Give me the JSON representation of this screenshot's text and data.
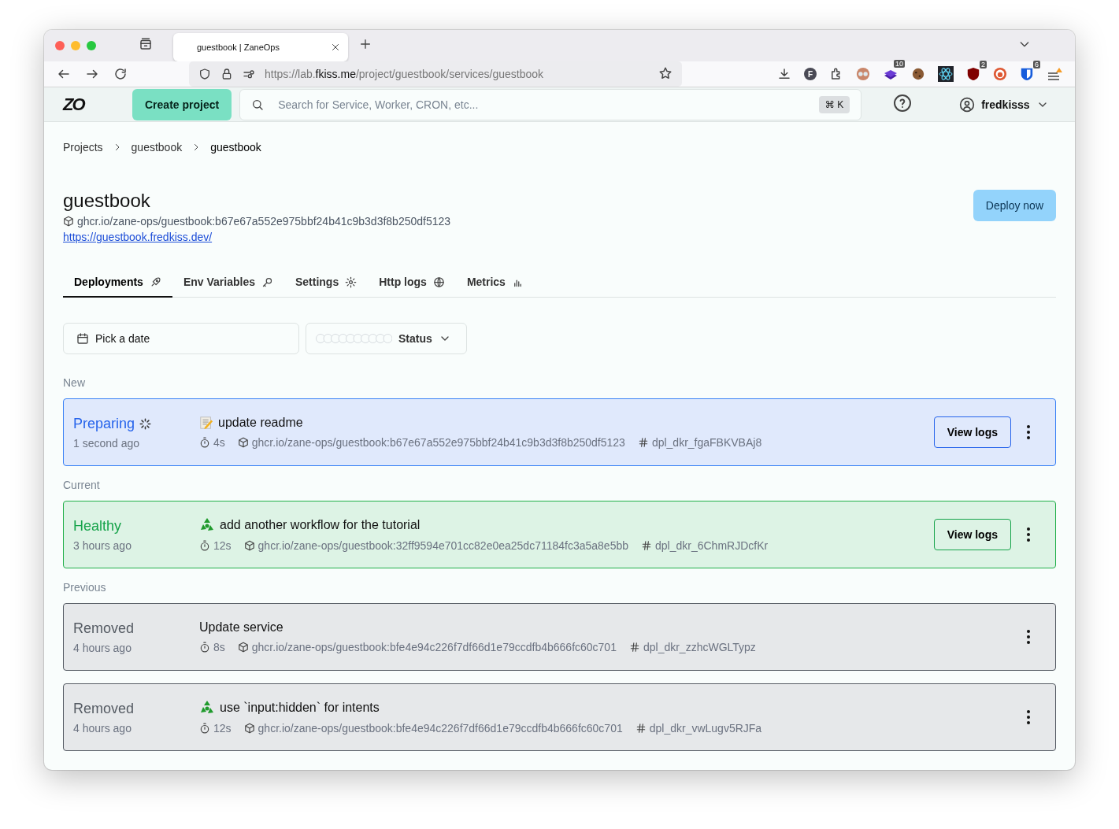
{
  "browser": {
    "tab_title": "guestbook | ZaneOps",
    "url_prefix": "https://lab.",
    "url_domain": "fkiss.me",
    "url_path": "/project/guestbook/services/guestbook",
    "extensions": [
      {
        "kind": "download"
      },
      {
        "kind": "letter",
        "letter": "F"
      },
      {
        "kind": "puzzle"
      },
      {
        "kind": "owl"
      },
      {
        "kind": "stack",
        "badge": "10"
      },
      {
        "kind": "cookie"
      },
      {
        "kind": "atom"
      },
      {
        "kind": "shield",
        "badge": "2"
      },
      {
        "kind": "duck"
      },
      {
        "kind": "vault",
        "badge": "6"
      },
      {
        "kind": "menu"
      }
    ]
  },
  "header": {
    "logo": "ZO",
    "create_button": "Create project",
    "search": {
      "placeholder": "Search for Service, Worker, CRON, etc..."
    },
    "shortcut": "⌘ K",
    "user": "fredkisss"
  },
  "breadcrumbs": [
    {
      "label": "Projects",
      "current": false
    },
    {
      "label": "guestbook",
      "current": false
    },
    {
      "label": "guestbook",
      "current": true
    }
  ],
  "service": {
    "name": "guestbook",
    "image": "ghcr.io/zane-ops/guestbook:b67e67a552e975bbf24b41c9b3d3f8b250df5123",
    "url": "https://guestbook.fredkiss.dev/",
    "deploy_button": "Deploy now"
  },
  "tabs": [
    {
      "label": "Deployments",
      "selected": true
    },
    {
      "label": "Env Variables",
      "selected": false
    },
    {
      "label": "Settings",
      "selected": false
    },
    {
      "label": "Http logs",
      "selected": false
    },
    {
      "label": "Metrics",
      "selected": false
    }
  ],
  "filters": {
    "date_placeholder": "Pick a date",
    "status_label": "Status"
  },
  "sections": [
    {
      "label": "New",
      "deployments": [
        {
          "status": "Preparing",
          "kind": "preparing",
          "time": "1 second ago",
          "emoji": {
            "kind": "memo"
          },
          "title": "update readme",
          "duration": "4s",
          "image": "ghcr.io/zane-ops/guestbook:b67e67a552e975bbf24b41c9b3d3f8b250df5123",
          "hash": "dpl_dkr_fgaFBKVBAj8",
          "logs_button": "View logs"
        }
      ]
    },
    {
      "label": "Current",
      "deployments": [
        {
          "status": "Healthy",
          "kind": "healthy",
          "time": "3 hours ago",
          "emoji": {
            "kind": "recycle"
          },
          "title": "add another workflow for the tutorial",
          "duration": "12s",
          "image": "ghcr.io/zane-ops/guestbook:32ff9594e701cc82e0ea25dc71184fc3a5a8e5bb",
          "hash": "dpl_dkr_6ChmRJDcfKr",
          "logs_button": "View logs"
        }
      ]
    },
    {
      "label": "Previous",
      "deployments": [
        {
          "status": "Removed",
          "kind": "removed",
          "time": "4 hours ago",
          "title": "Update service",
          "duration": "8s",
          "image": "ghcr.io/zane-ops/guestbook:bfe4e94c226f7df66d1e79ccdfb4b666fc60c701",
          "hash": "dpl_dkr_zzhcWGLTypz"
        },
        {
          "status": "Removed",
          "kind": "removed",
          "time": "4 hours ago",
          "emoji": {
            "kind": "recycle"
          },
          "title": "use `input:hidden` for intents",
          "duration": "12s",
          "image": "ghcr.io/zane-ops/guestbook:bfe4e94c226f7df66d1e79ccdfb4b666fc60c701",
          "hash": "dpl_dkr_vwLugv5RJFa"
        }
      ]
    }
  ]
}
